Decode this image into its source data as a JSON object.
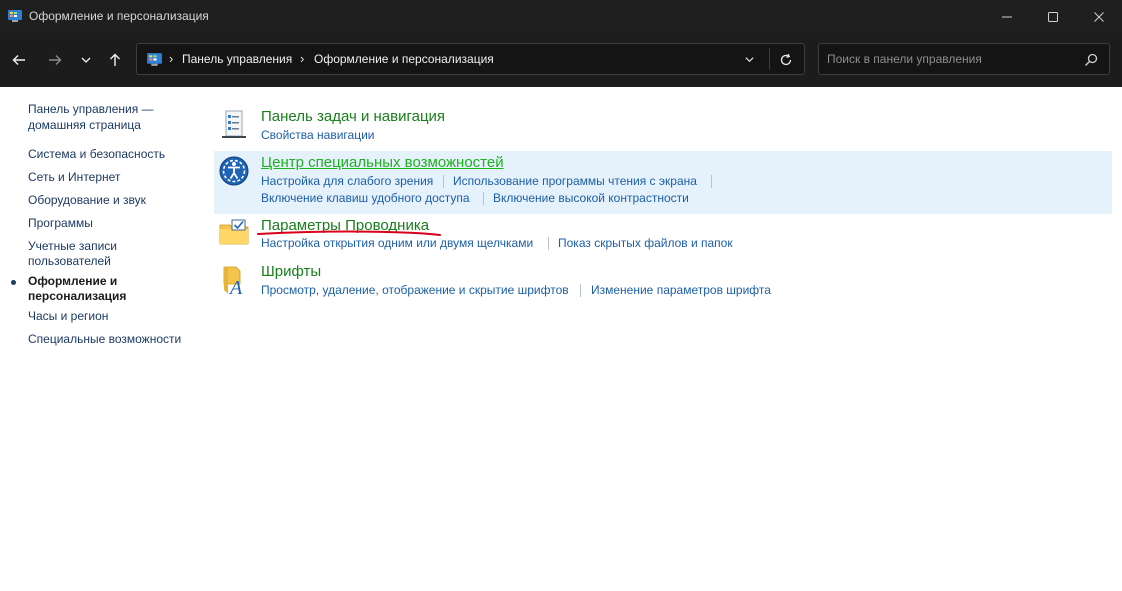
{
  "window": {
    "title": "Оформление и персонализация",
    "minimize_icon": "minimize-icon",
    "maximize_icon": "maximize-icon",
    "close_icon": "close-icon"
  },
  "navigation": {
    "back_icon": "arrow-left-icon",
    "forward_icon": "arrow-right-icon",
    "recent_icon": "chevron-down-icon",
    "up_icon": "arrow-up-icon"
  },
  "address_bar": {
    "breadcrumbs": [
      "Панель управления",
      "Оформление и персонализация"
    ],
    "separator": "›"
  },
  "search": {
    "placeholder": "Поиск в панели управления"
  },
  "sidebar": {
    "home": "Панель управления — домашняя страница",
    "items": [
      {
        "label": "Система и безопасность",
        "active": false
      },
      {
        "label": "Сеть и Интернет",
        "active": false
      },
      {
        "label": "Оборудование и звук",
        "active": false
      },
      {
        "label": "Программы",
        "active": false
      },
      {
        "label": "Учетные записи пользователей",
        "active": false
      },
      {
        "label": "Оформление и персонализация",
        "active": true
      },
      {
        "label": "Часы и регион",
        "active": false
      },
      {
        "label": "Специальные возможности",
        "active": false
      }
    ]
  },
  "categories": [
    {
      "title": "Панель задач и навигация",
      "icon": "taskbar-icon",
      "links": [
        "Свойства навигации"
      ]
    },
    {
      "title": "Центр специальных возможностей",
      "icon": "accessibility-icon",
      "hovered": true,
      "links": [
        "Настройка для слабого зрения",
        "Использование программы чтения с экрана",
        "Включение клавиш удобного доступа",
        "Включение высокой контрастности"
      ]
    },
    {
      "title": "Параметры Проводника",
      "icon": "folder-options-icon",
      "annotated": true,
      "links": [
        "Настройка открытия одним или двумя щелчками",
        "Показ скрытых файлов и папок"
      ]
    },
    {
      "title": "Шрифты",
      "icon": "fonts-icon",
      "links": [
        "Просмотр, удаление, отображение и скрытие шрифтов",
        "Изменение параметров шрифта"
      ]
    }
  ],
  "colors": {
    "category_title": "#197e1b",
    "category_title_hover": "#1fb21f",
    "link": "#1c5fa8",
    "highlight_bg": "#e5f1fb",
    "annotation": "#d9001b"
  }
}
